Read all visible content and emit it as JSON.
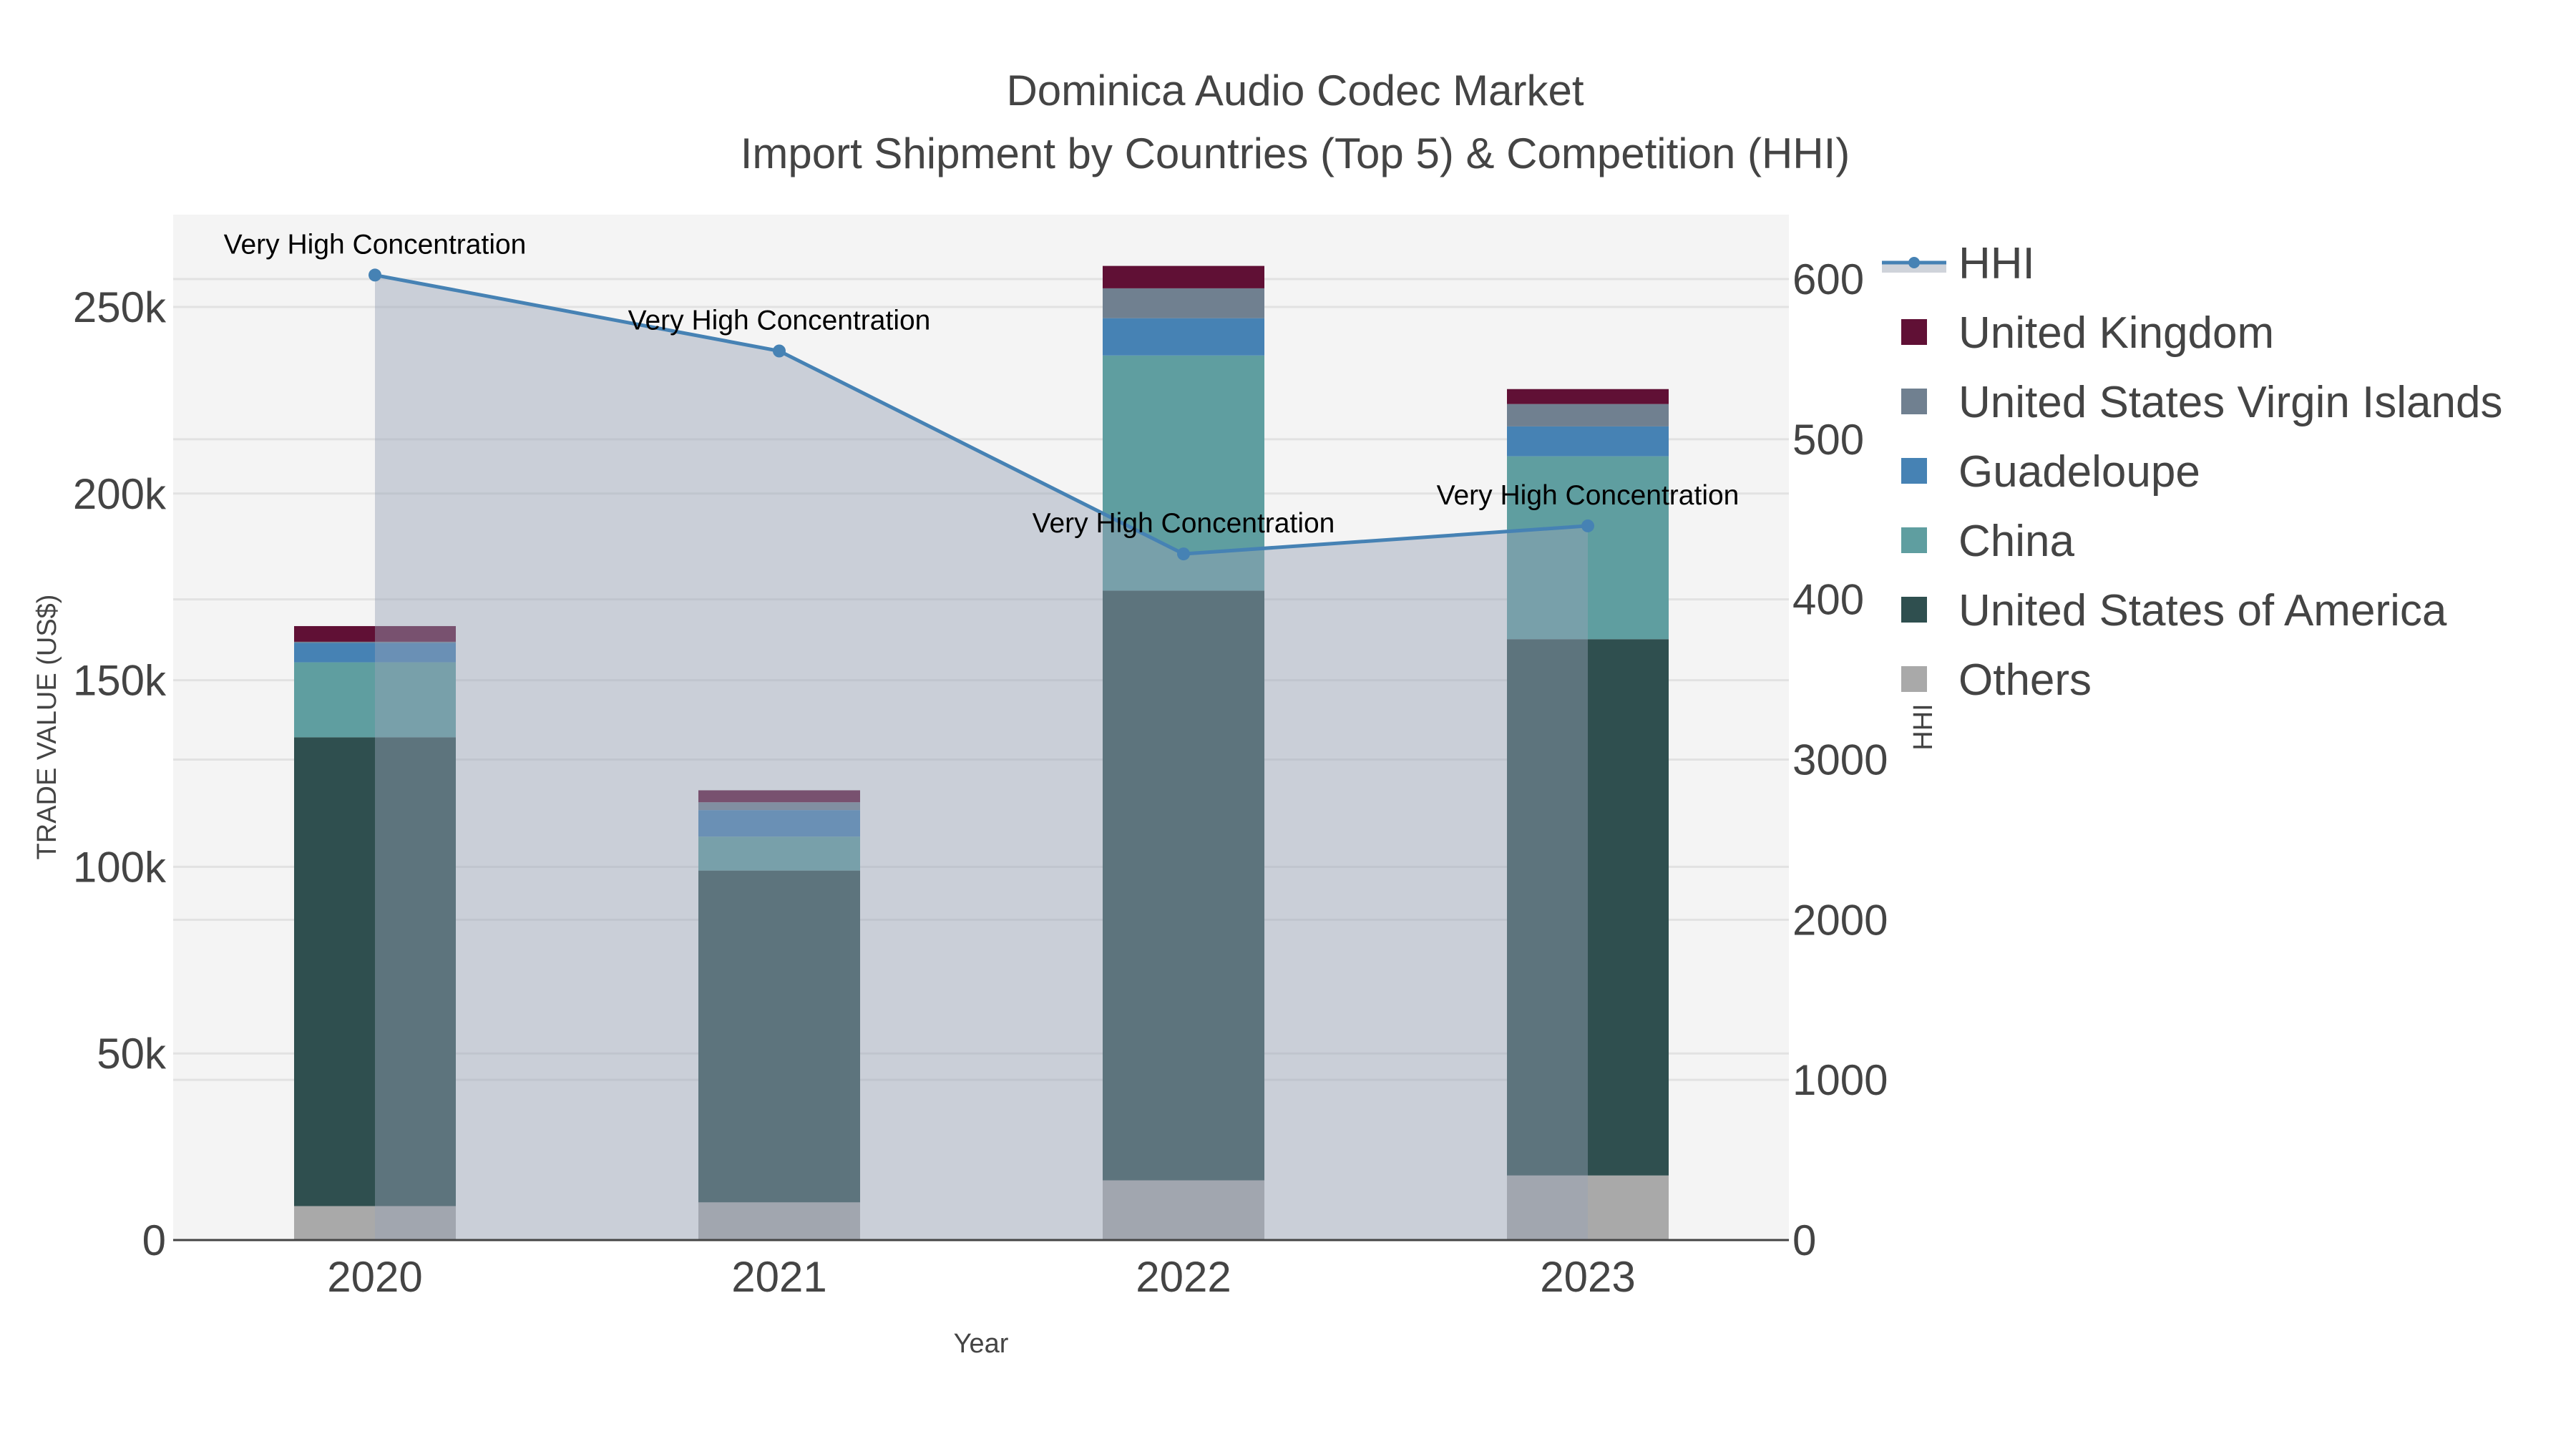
{
  "chart_data": {
    "type": "bar",
    "title": "Dominica Audio Codec Market",
    "subtitle": "Import Shipment by Countries (Top 5) & Competition (HHI)",
    "xlabel": "Year",
    "ylabel": "TRADE VALUE (US$)",
    "y2label": "HHI",
    "categories": [
      "2020",
      "2021",
      "2022",
      "2023"
    ],
    "ylim": [
      0,
      275000
    ],
    "y2lim": [
      0,
      6400
    ],
    "yticks": [
      {
        "v": 0,
        "label": "0"
      },
      {
        "v": 50000,
        "label": "50k"
      },
      {
        "v": 100000,
        "label": "100k"
      },
      {
        "v": 150000,
        "label": "150k"
      },
      {
        "v": 200000,
        "label": "200k"
      },
      {
        "v": 250000,
        "label": "250k"
      }
    ],
    "y2ticks": [
      {
        "v": 0,
        "label": "0"
      },
      {
        "v": 1000,
        "label": "1000"
      },
      {
        "v": 2000,
        "label": "2000"
      },
      {
        "v": 3000,
        "label": "3000"
      },
      {
        "v": 4000,
        "label": "400"
      },
      {
        "v": 5000,
        "label": "500"
      },
      {
        "v": 6000,
        "label": "600"
      }
    ],
    "stacked": true,
    "series": [
      {
        "name": "Others",
        "color": "#a9a9a9",
        "values": [
          9100,
          10100,
          16000,
          17300
        ]
      },
      {
        "name": "United States of America",
        "color": "#2f4f4f",
        "values": [
          125600,
          88900,
          158000,
          143700
        ]
      },
      {
        "name": "China",
        "color": "#5f9ea0",
        "values": [
          20100,
          9100,
          63000,
          49000
        ]
      },
      {
        "name": "Guadeloupe",
        "color": "#4682b4",
        "values": [
          5200,
          7100,
          10000,
          8000
        ]
      },
      {
        "name": "United States Virgin Islands",
        "color": "#708090",
        "values": [
          300,
          2100,
          8000,
          6000
        ]
      },
      {
        "name": "United Kingdom",
        "color": "#601035",
        "values": [
          4200,
          3200,
          6000,
          4000
        ]
      }
    ],
    "line": {
      "name": "HHI",
      "color": "#4682b4",
      "axis": "y2",
      "fill": "tozeroy",
      "values": [
        6025,
        5551,
        4284,
        4459
      ]
    },
    "annotations": [
      "Very High Concentration",
      "Very High Concentration",
      "Very High Concentration",
      "Very High Concentration"
    ],
    "legend_order": [
      "HHI",
      "United Kingdom",
      "United States Virgin Islands",
      "Guadeloupe",
      "China",
      "United States of America",
      "Others"
    ],
    "legend": "right",
    "grid": true
  }
}
